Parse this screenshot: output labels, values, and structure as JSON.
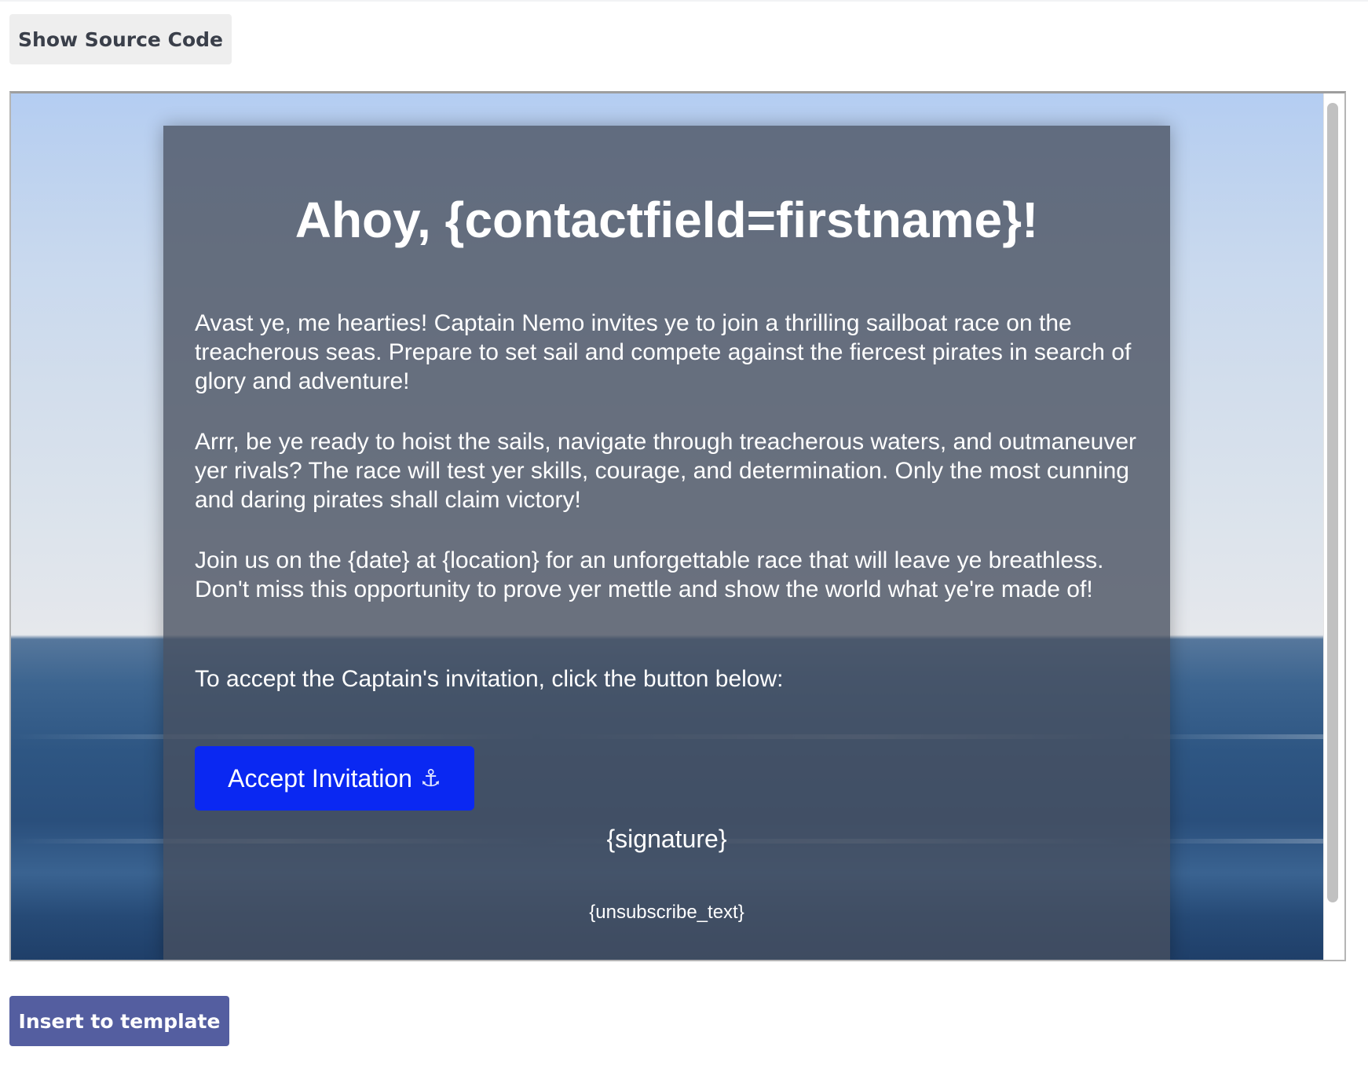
{
  "toolbar": {
    "show_source_label": "Show Source Code"
  },
  "email": {
    "heading": "Ahoy, {contactfield=firstname}!",
    "paragraphs": [
      "Avast ye, me hearties! Captain Nemo invites ye to join a thrilling sailboat race on the treacherous seas. Prepare to set sail and compete against the fiercest pirates in search of glory and adventure!",
      "Arrr, be ye ready to hoist the sails, navigate through treacherous waters, and outmaneuver yer rivals? The race will test yer skills, courage, and determination. Only the most cunning and daring pirates shall claim victory!",
      "Join us on the {date} at {location} for an unforgettable race that will leave ye breathless. Don't miss this opportunity to prove yer mettle and show the world what ye're made of!",
      "To accept the Captain's invitation, click the button below:"
    ],
    "accept_button_label": "Accept Invitation",
    "accept_button_icon": "⚓",
    "signature": "{signature}",
    "unsubscribe": "{unsubscribe_text}",
    "button_color": "#0a28f2"
  },
  "footer": {
    "insert_label": "Insert to template",
    "insert_color": "#545ea0"
  }
}
